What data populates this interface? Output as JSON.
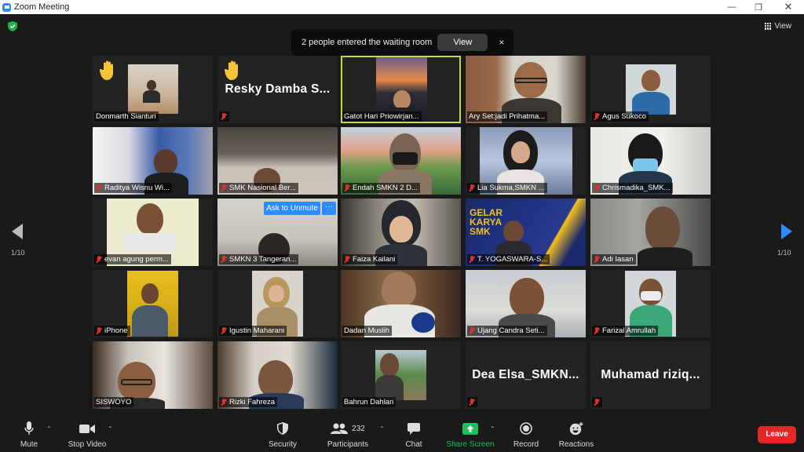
{
  "window": {
    "title": "Zoom Meeting"
  },
  "header": {
    "view_label": "View"
  },
  "notification": {
    "text": "2 people entered the waiting room",
    "view_button": "View",
    "close": "×"
  },
  "pagination": {
    "left": "1/10",
    "right": "1/10"
  },
  "participants": [
    {
      "name": "Donmarth Sianturi",
      "muted": true,
      "raised_hand": true
    },
    {
      "name": "Resky Damba S...",
      "muted": true,
      "raised_hand": true,
      "video": false
    },
    {
      "name": "Gatot Hari Priowirjan...",
      "muted": false,
      "active_speaker": true
    },
    {
      "name": "Ary Set:jadi Prihatma...",
      "muted": false
    },
    {
      "name": "Agus Sukoco",
      "muted": true
    },
    {
      "name": "Raditya Wisnu Wi...",
      "muted": true
    },
    {
      "name": "SMK Nasional Ber...",
      "muted": true
    },
    {
      "name": "Endah SMKN 2 D...",
      "muted": true
    },
    {
      "name": "Lia Sukma,SMKN ...",
      "muted": true
    },
    {
      "name": "Chrismadika_SMK...",
      "muted": true
    },
    {
      "name": "evan agung perm...",
      "muted": true
    },
    {
      "name": "SMKN 3 Tangeran...",
      "muted": true,
      "ask_to_unmute": "Ask to Unmute",
      "more": "···"
    },
    {
      "name": "Faiza Kailani",
      "muted": true
    },
    {
      "name": "T. YOGASWARA-S...",
      "muted": true,
      "banner": "GELAR KARYA SMK"
    },
    {
      "name": "Adi Iasan",
      "muted": true
    },
    {
      "name": "iPhone",
      "muted": true
    },
    {
      "name": "Igustin Maharani",
      "muted": true
    },
    {
      "name": "Dadan Muslih",
      "muted": false
    },
    {
      "name": "Ujang Candra Seti...",
      "muted": true
    },
    {
      "name": "Farizal Amrullah",
      "muted": true
    },
    {
      "name": "SISWOYO",
      "muted": false
    },
    {
      "name": "Rizki Fahreza",
      "muted": true
    },
    {
      "name": "Bahrun Dahlan",
      "muted": false
    },
    {
      "name": "Dea Elsa_SMKN...",
      "muted": true,
      "video": false
    },
    {
      "name": "Muhamad riziq...",
      "muted": true,
      "video": false
    }
  ],
  "toolbar": {
    "mute": "Mute",
    "stop_video": "Stop Video",
    "security": "Security",
    "participants": "Participants",
    "participants_count": "232",
    "chat": "Chat",
    "share_screen": "Share Screen",
    "record": "Record",
    "reactions": "Reactions",
    "leave": "Leave"
  },
  "colors": {
    "accent": "#2d8cff",
    "share": "#1fbf5b",
    "leave": "#e02828",
    "muted": "#e02f2f",
    "active_border": "#c5d940"
  }
}
